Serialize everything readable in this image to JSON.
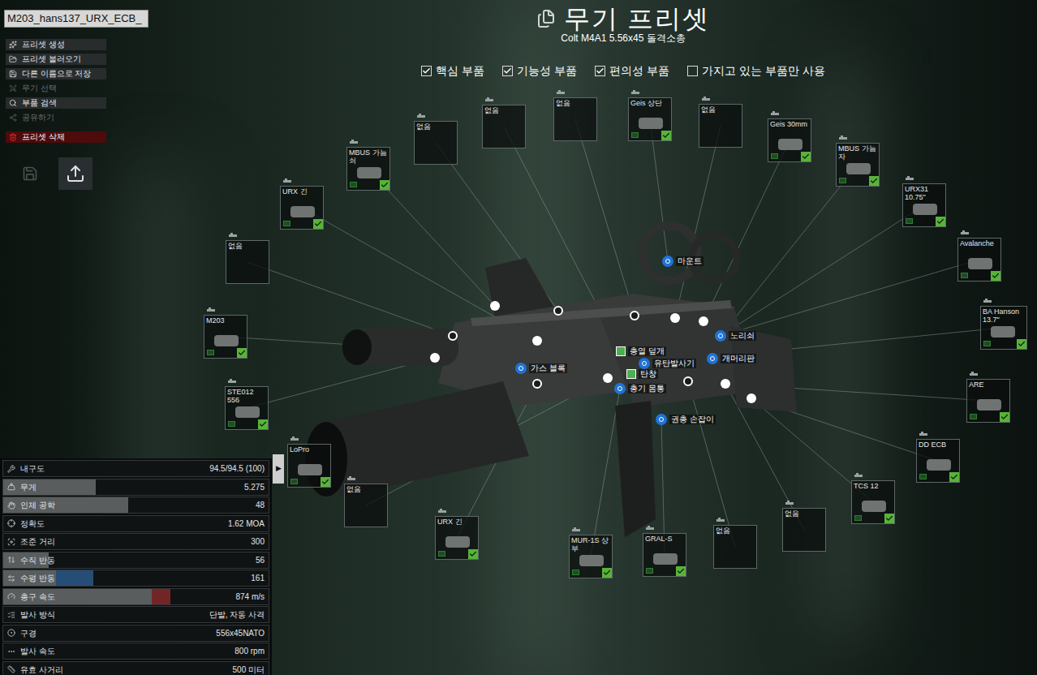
{
  "preset_name": {
    "value": "M203_hans137_URX_ECB_"
  },
  "menu": [
    {
      "label": "프리셋 생성",
      "disabled": false,
      "danger": false
    },
    {
      "label": "프리셋 불러오기",
      "disabled": false,
      "danger": false
    },
    {
      "label": "다른 이름으로 저장",
      "disabled": false,
      "danger": false
    },
    {
      "label": "무기 선택",
      "disabled": true,
      "danger": false
    },
    {
      "label": "부품 검색",
      "disabled": false,
      "danger": false
    },
    {
      "label": "공유하기",
      "disabled": true,
      "danger": false
    },
    {
      "label": "프리셋 삭제",
      "disabled": false,
      "danger": true
    }
  ],
  "quick_buttons": [
    {
      "kind": "save",
      "disabled": true
    },
    {
      "kind": "export",
      "disabled": false
    }
  ],
  "header": {
    "title": "무기 프리셋",
    "subtitle": "Colt M4A1 5.56x45 돌격소총"
  },
  "filters": [
    {
      "label": "핵심 부품",
      "checked": true
    },
    {
      "label": "기능성 부품",
      "checked": true
    },
    {
      "label": "편의성 부품",
      "checked": true
    },
    {
      "label": "가지고 있는 부품만 사용",
      "checked": false
    }
  ],
  "slots": [
    {
      "label": "없음",
      "filled": false
    },
    {
      "label": "URX 긴",
      "filled": true
    },
    {
      "label": "MBUS 가늠쇠",
      "filled": true
    },
    {
      "label": "없음",
      "filled": false
    },
    {
      "label": "없음",
      "filled": false
    },
    {
      "label": "없음",
      "filled": false
    },
    {
      "label": "Geis 상단",
      "filled": true
    },
    {
      "label": "없음",
      "filled": false
    },
    {
      "label": "Geis 30mm",
      "filled": true
    },
    {
      "label": "MBUS 가늠자",
      "filled": true
    },
    {
      "label": "URX31 10.75\"",
      "filled": true
    },
    {
      "label": "Avalanche",
      "filled": true
    },
    {
      "label": "BA Hanson 13.7\"",
      "filled": true
    },
    {
      "label": "ARE",
      "filled": true
    },
    {
      "label": "DD ECB",
      "filled": true
    },
    {
      "label": "TCS 12",
      "filled": true
    },
    {
      "label": "없음",
      "filled": false
    },
    {
      "label": "없음",
      "filled": false
    },
    {
      "label": "GRAL-S",
      "filled": true
    },
    {
      "label": "MUR-1S 상부",
      "filled": true
    },
    {
      "label": "URX 긴",
      "filled": true
    },
    {
      "label": "없음",
      "filled": false
    },
    {
      "label": "LoPro",
      "filled": true
    },
    {
      "label": "STE012 556",
      "filled": true
    },
    {
      "label": "M203",
      "filled": true
    }
  ],
  "points": [
    {
      "label": "마운트",
      "kind": "round"
    },
    {
      "label": "노리쇠",
      "kind": "round"
    },
    {
      "label": "개머리판",
      "kind": "round"
    },
    {
      "label": "총열 덮개",
      "kind": "square"
    },
    {
      "label": "유탄발사기",
      "kind": "round"
    },
    {
      "label": "탄창",
      "kind": "square"
    },
    {
      "label": "가스 블록",
      "kind": "round"
    },
    {
      "label": "총기 몸통",
      "kind": "round"
    },
    {
      "label": "권총 손잡이",
      "kind": "round"
    }
  ],
  "stats_toggle": "▶",
  "stats": [
    {
      "label": "내구도",
      "value": "94.5/94.5 (100)"
    },
    {
      "label": "무게",
      "value": "5.275",
      "level": 0.35
    },
    {
      "label": "인체 공학",
      "value": "48",
      "level": 0.47
    },
    {
      "label": "정확도",
      "value": "1.62 MOA"
    },
    {
      "label": "조준 거리",
      "value": "300"
    },
    {
      "label": "수직 반동",
      "value": "56",
      "level": 0.17
    },
    {
      "label": "수평 반동",
      "value": "161",
      "level": 0.2,
      "change": 0.14,
      "change_color": "#2c5d8f"
    },
    {
      "label": "총구 속도",
      "value": "874 m/s",
      "level": 0.56,
      "change": 0.07,
      "change_color": "#8c2a2a"
    },
    {
      "label": "발사 방식",
      "value": "단발, 자동 사격"
    },
    {
      "label": "구경",
      "value": "556x45NATO"
    },
    {
      "label": "발사 속도",
      "value": "800 rpm"
    },
    {
      "label": "유효 사거리",
      "value": "500 미터"
    }
  ]
}
